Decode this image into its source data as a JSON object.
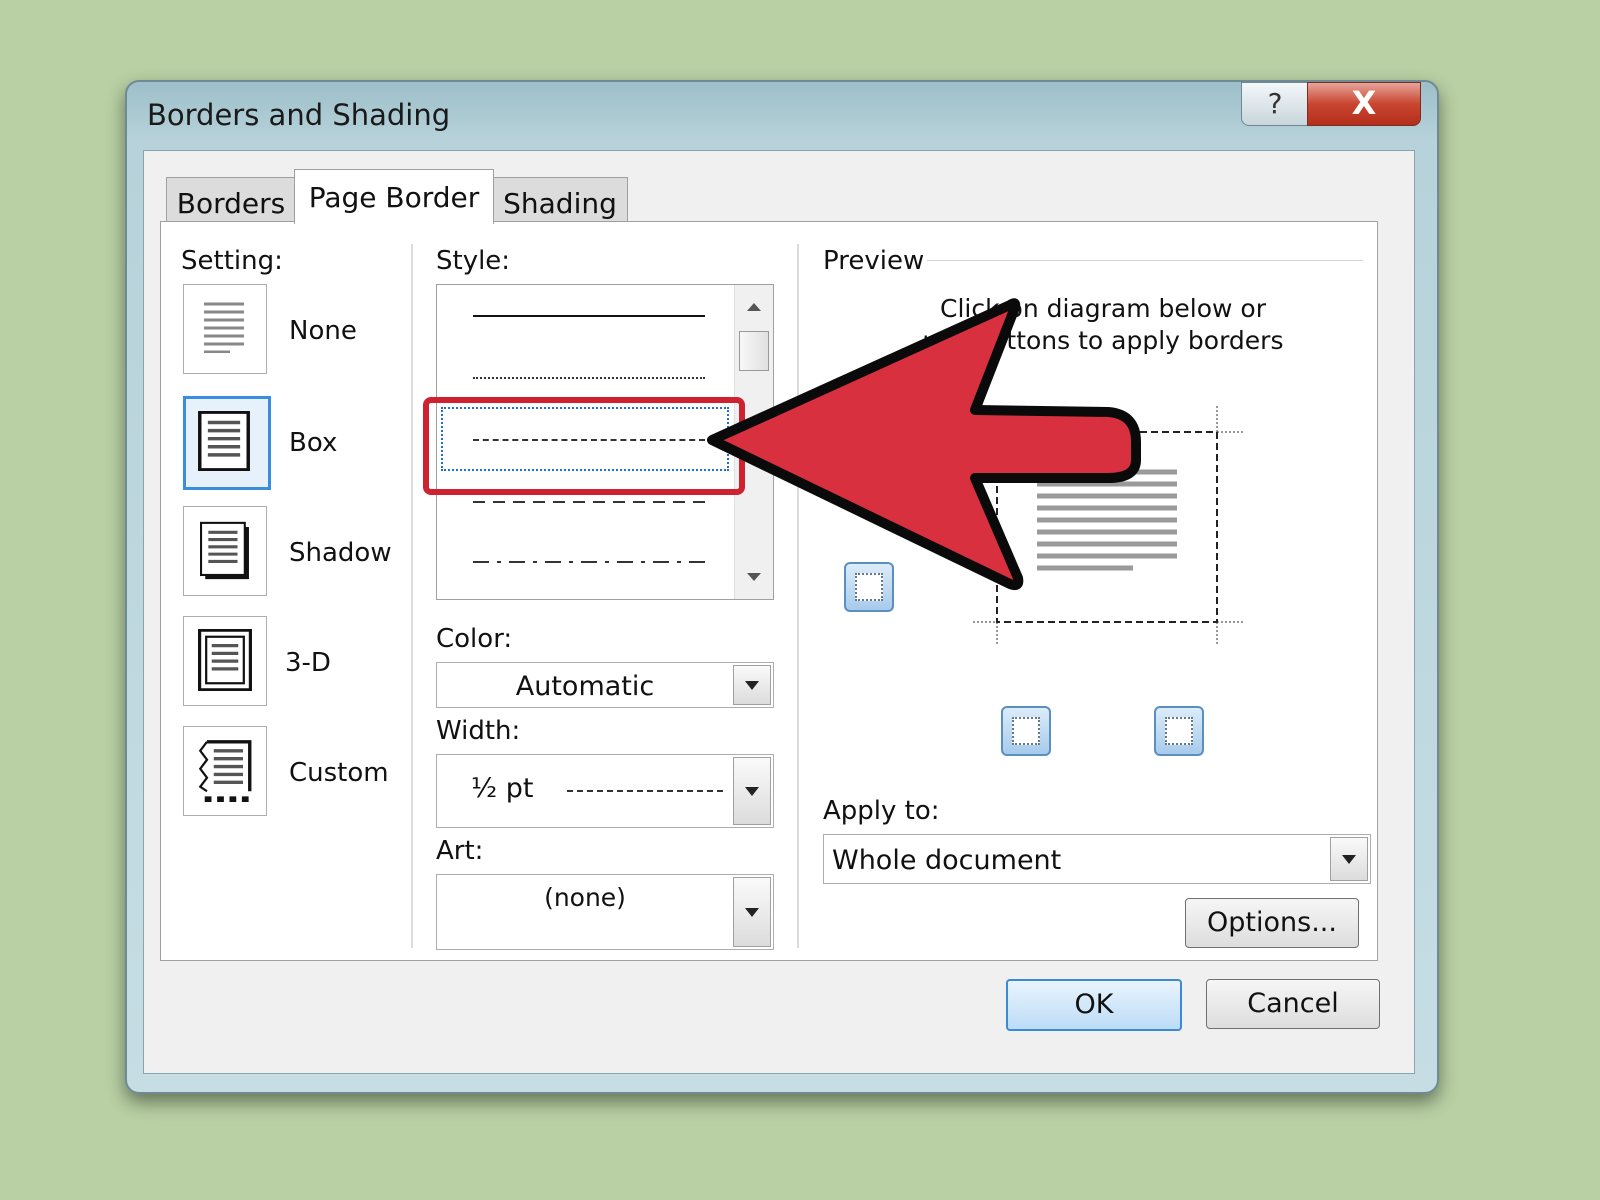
{
  "window": {
    "title": "Borders and Shading",
    "help": "?",
    "close": "X"
  },
  "tabs": [
    {
      "label": "Borders",
      "active": false
    },
    {
      "label": "Page Border",
      "active": true
    },
    {
      "label": "Shading",
      "active": false
    }
  ],
  "setting": {
    "label": "Setting:",
    "items": [
      {
        "label": "None",
        "selected": false
      },
      {
        "label": "Box",
        "selected": true
      },
      {
        "label": "Shadow",
        "selected": false
      },
      {
        "label": "3-D",
        "selected": false
      },
      {
        "label": "Custom",
        "selected": false
      }
    ]
  },
  "style": {
    "label": "Style:",
    "selected_index": 2,
    "items": [
      "solid",
      "dotted",
      "dashed-fine",
      "dashed",
      "dash-dot"
    ]
  },
  "color": {
    "label": "Color:",
    "value": "Automatic"
  },
  "width": {
    "label": "Width:",
    "value": "½ pt"
  },
  "art": {
    "label": "Art:",
    "value": "(none)"
  },
  "preview": {
    "label": "Preview",
    "instruction_line1": "Click on diagram below or",
    "instruction_line2": "use buttons to apply borders"
  },
  "apply_to": {
    "label": "Apply to:",
    "value": "Whole document"
  },
  "buttons": {
    "options": "Options...",
    "ok": "OK",
    "cancel": "Cancel"
  },
  "colors": {
    "highlight": "#cf2231",
    "arrow_fill": "#d9303f",
    "background": "#b8d0a3"
  }
}
